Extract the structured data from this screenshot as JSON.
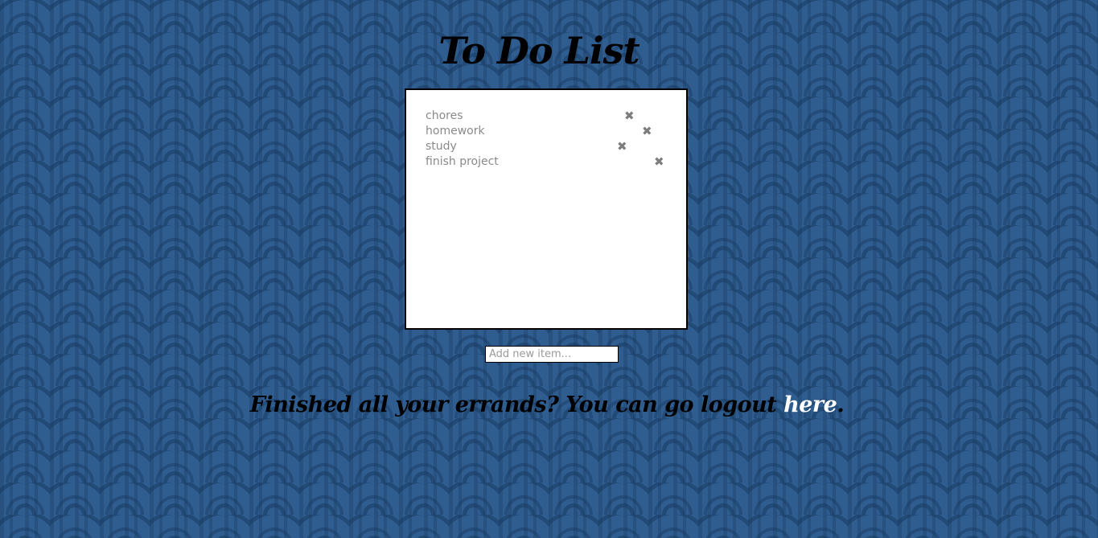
{
  "header": {
    "title": "To Do List"
  },
  "todo": {
    "items": [
      {
        "label": "chores",
        "delete_icon": "x-icon"
      },
      {
        "label": "homework",
        "delete_icon": "x-icon"
      },
      {
        "label": "study",
        "delete_icon": "x-icon"
      },
      {
        "label": "finish project",
        "delete_icon": "x-icon"
      }
    ],
    "delete_glyph": "✖"
  },
  "input": {
    "placeholder": "Add new item...",
    "value": ""
  },
  "footer": {
    "text": "Finished all your errands? You can go logout ",
    "link_label": "here",
    "end": "."
  },
  "colors": {
    "background": "#2f5d8f",
    "item_text": "#8a8a8a",
    "link": "#ffffff"
  }
}
